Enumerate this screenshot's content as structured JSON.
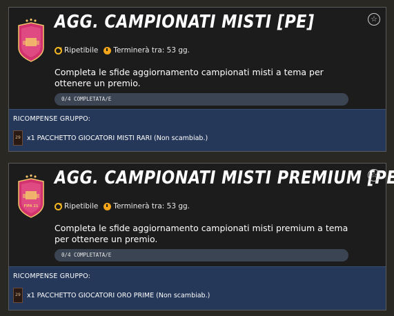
{
  "objectives": [
    {
      "title": "AGG. CAMPIONATI MISTI [PE]",
      "repeat_label": "Ripetibile",
      "expiry_label": "Terminerà tra: 53 gg.",
      "description": "Completa le sfide aggiornamento campionati misti a tema per ottenere un premio.",
      "progress_text": "0/4 COMPLETATA/E",
      "progress": 0,
      "rewards_title": "RICOMPENSE GRUPPO:",
      "reward_label": "x1 PACCHETTO GIOCATORI MISTI RARI (Non scambiab.)",
      "pack_text": "29"
    },
    {
      "title": "AGG. CAMPIONATI MISTI PREMIUM [PE]",
      "repeat_label": "Ripetibile",
      "expiry_label": "Terminerà tra: 53 gg.",
      "description": "Completa le sfide aggiornamento campionati misti premium a tema per ottenere un premio.",
      "progress_text": "0/4 COMPLETATA/E",
      "progress": 0,
      "rewards_title": "RICOMPENSE GRUPPO:",
      "reward_label": "x1 PACCHETTO GIOCATORI ORO PRIME (Non scambiab.)",
      "pack_text": "29",
      "badge_text": "FIFA 21"
    }
  ],
  "icons": {
    "repeat": "repeat-icon",
    "timer": "timer-icon",
    "favorite": "star-icon",
    "badge": "objective-badge-icon",
    "pack": "player-pack-icon"
  },
  "colors": {
    "accent": "#f5b722",
    "rewards_bg": "#253859",
    "progress_bg": "#3b4452",
    "badge_pink": "#d63a7a"
  }
}
